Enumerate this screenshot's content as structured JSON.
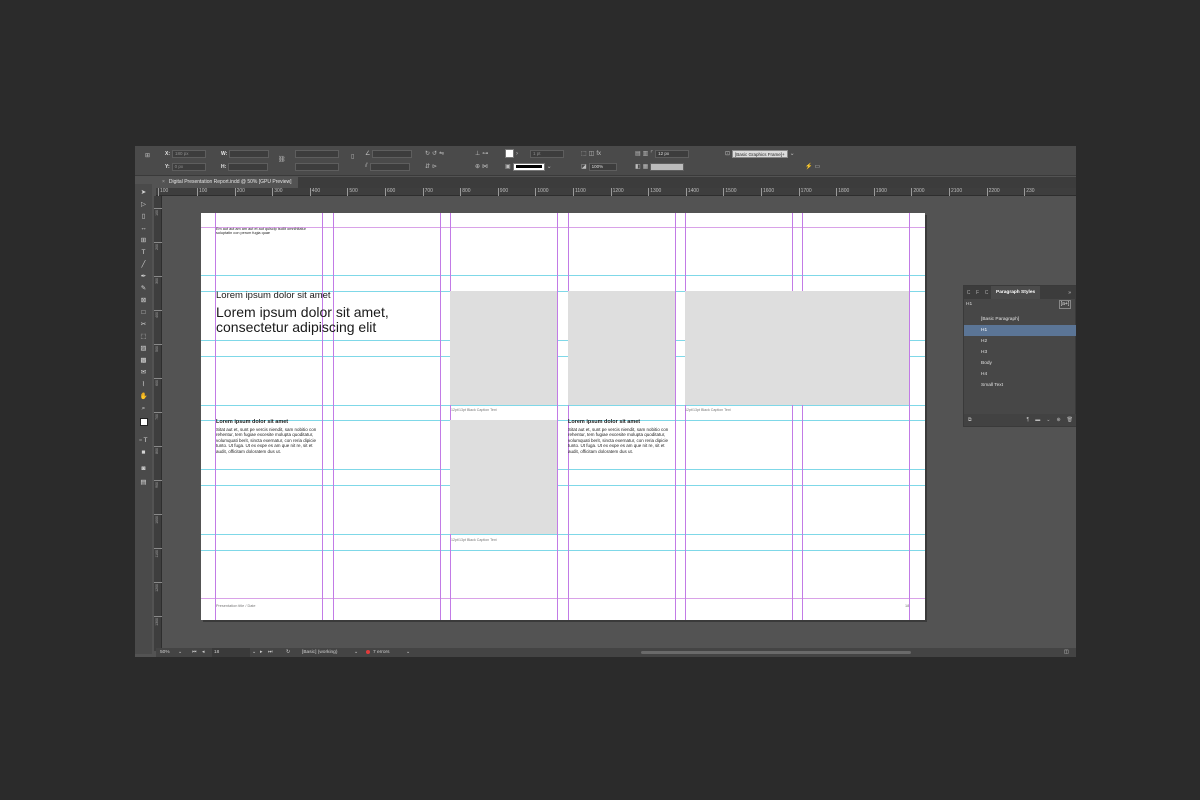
{
  "control_panel": {
    "x_label": "X:",
    "x_value": "180 px",
    "y_label": "Y:",
    "y_value": "0 px",
    "w_label": "W:",
    "h_label": "H:",
    "stroke_weight": "1 pt",
    "opacity": "100%",
    "corner_size": "12 px",
    "frame_style": "[Basic Graphics Frame]+"
  },
  "tab": {
    "title": "Digital Presentation Report.indd @ 50% [GPU Preview]",
    "close": "×"
  },
  "ruler": {
    "h_ticks": [
      "100",
      "100",
      "200",
      "300",
      "400",
      "500",
      "600",
      "700",
      "800",
      "900",
      "1000",
      "1100",
      "1200",
      "1300",
      "1400",
      "1500",
      "1600",
      "1700",
      "1800",
      "1900",
      "2000",
      "2100",
      "2200",
      "230"
    ],
    "v_ticks": [
      "100",
      "200",
      "300",
      "400",
      "500",
      "600",
      "700",
      "800",
      "900",
      "1000",
      "1100",
      "1200",
      "1300"
    ]
  },
  "page": {
    "header_small": "Em aut aut am am aut et aut quiscip iscilit omnihitatur soluptatin con perum fugia quae",
    "subtitle": "Lorem ipsum dolor sit amet",
    "title": "Lorem ipsum dolor sit amet, consectetur adipiscing elit",
    "col1_heading": "Lorem ipsum dolor sit amet",
    "col1_body": "Sitat aut et, sunt pe vercis niendit, sam nobitio con rehentur, tem fugiae excesite molupta quoditatur, volumquati berit, sincta exernatur, con reria dipicie tunto. Ut fuga. Ut ex expe es am que nit re, sit et audit, officitam doloratem dus ut.",
    "col2_heading": "Lorem ipsum dolor sit amet",
    "col2_body": "Sitat aut et, sunt pe vercis niendit, sam nobitio con rehentur, tem fugiae excesite molupta quoditatur, volumquati berit, sincta exernatur, con reria dipicie tunto. Ut fuga. Ut ex expe es am que nit re, sit et audit, officitam doloratem dus ut.",
    "caption_1": "12pt/13pt Black Caption Text",
    "caption_2": "12pt/13pt Black Caption Text",
    "caption_3": "12pt/13pt Black Caption Text",
    "footer_left": "Presentation title  /  Date",
    "footer_right": "18"
  },
  "paragraph_styles": {
    "tabs": [
      "C",
      "F",
      "C"
    ],
    "title": "Paragraph Styles",
    "collapse": "»",
    "current": "H1",
    "new_button": "[a+]",
    "items": [
      "[Basic Paragraph]",
      "H1",
      "H2",
      "H3",
      "Body",
      "H4",
      "Small Text"
    ],
    "selected": "H1"
  },
  "status_bar": {
    "zoom": "50%",
    "page_number": "18",
    "preflight_profile": "[Basic] (working)",
    "errors": "7 errors"
  },
  "colors": {
    "app_bg": "#535353",
    "page": "#ffffff",
    "margin_guides": "#c27be6",
    "grid_guides": "#7fd8e8",
    "selection": "#5b7596",
    "error": "#e23b3b"
  }
}
